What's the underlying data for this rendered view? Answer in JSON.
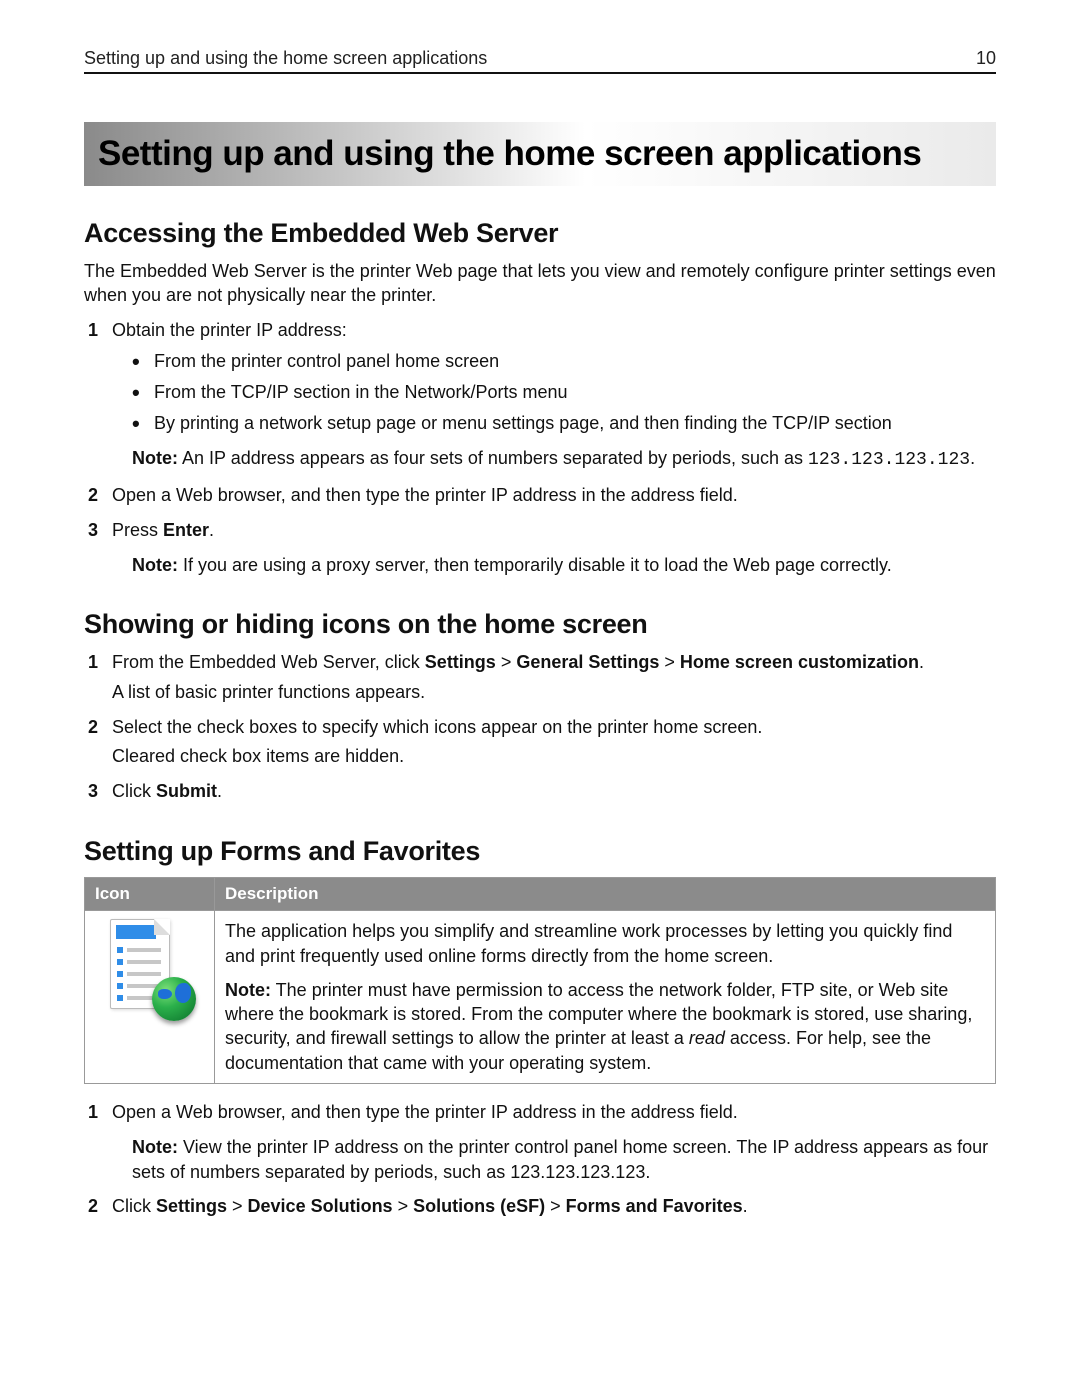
{
  "header": {
    "title": "Setting up and using the home screen applications",
    "page_number": "10"
  },
  "main_title": "Setting up and using the home screen applications",
  "sections": {
    "s1": {
      "heading": "Accessing the Embedded Web Server",
      "intro": "The Embedded Web Server is the printer Web page that lets you view and remotely configure printer settings even when you are not physically near the printer.",
      "step1": "Obtain the printer IP address:",
      "b1": "From the printer control panel home screen",
      "b2": "From the TCP/IP section in the Network/Ports menu",
      "b3": "By printing a network setup page or menu settings page, and then finding the TCP/IP section",
      "note1_label": "Note:",
      "note1_text": " An IP address appears as four sets of numbers separated by periods, such as ",
      "note1_code": "123.123.123.123",
      "note1_tail": ".",
      "step2": "Open a Web browser, and then type the printer IP address in the address field.",
      "step3_pre": "Press ",
      "step3_bold": "Enter",
      "step3_post": ".",
      "note2_label": "Note:",
      "note2_text": " If you are using a proxy server, then temporarily disable it to load the Web page correctly."
    },
    "s2": {
      "heading": "Showing or hiding icons on the home screen",
      "step1_pre": "From the Embedded Web Server, click ",
      "step1_b1": "Settings",
      "gt": " > ",
      "step1_b2": "General Settings",
      "step1_b3": "Home screen customization",
      "step1_post": ".",
      "step1_sub": "A list of basic printer functions appears.",
      "step2": "Select the check boxes to specify which icons appear on the printer home screen.",
      "step2_sub": "Cleared check box items are hidden.",
      "step3_pre": "Click ",
      "step3_bold": "Submit",
      "step3_post": "."
    },
    "s3": {
      "heading": "Setting up Forms and Favorites",
      "table": {
        "col_icon": "Icon",
        "col_desc": "Description",
        "desc1": "The application helps you simplify and streamline work processes by letting you quickly find and print frequently used online forms directly from the home screen.",
        "note_label": "Note:",
        "note_a": " The printer must have permission to access the network folder, FTP site, or Web site where the bookmark is stored. From the computer where the bookmark is stored, use sharing, security, and firewall settings to allow the printer at least a ",
        "note_i": "read",
        "note_b": " access. For help, see the documentation that came with your operating system."
      },
      "step1": "Open a Web browser, and then type the printer IP address in the address field.",
      "step1_note_label": "Note:",
      "step1_note": " View the printer IP address on the printer control panel home screen. The IP address appears as four sets of numbers separated by periods, such as 123.123.123.123.",
      "step2_pre": "Click ",
      "step2_b1": "Settings",
      "step2_b2": "Device Solutions",
      "step2_b3": "Solutions (eSF)",
      "step2_b4": "Forms and Favorites",
      "step2_post": "."
    }
  }
}
